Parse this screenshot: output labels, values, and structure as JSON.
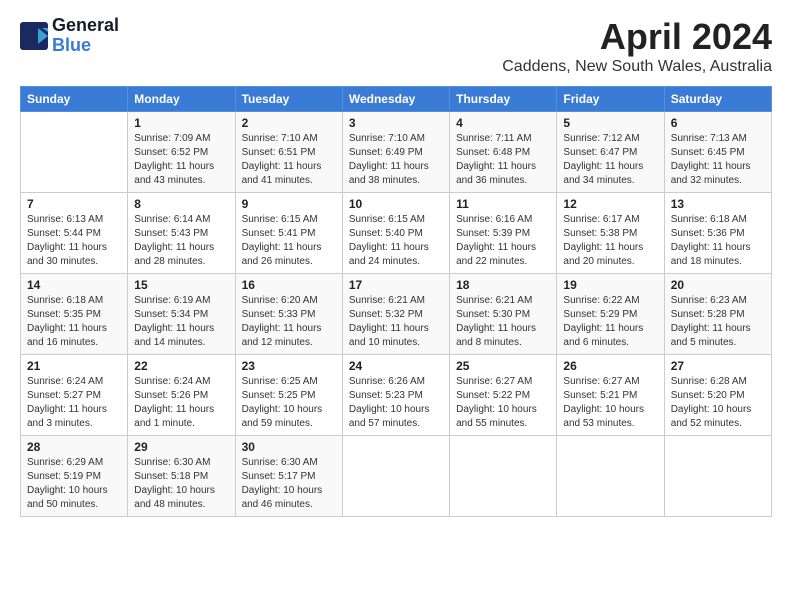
{
  "logo": {
    "line1": "General",
    "line2": "Blue"
  },
  "title": "April 2024",
  "subtitle": "Caddens, New South Wales, Australia",
  "days_header": [
    "Sunday",
    "Monday",
    "Tuesday",
    "Wednesday",
    "Thursday",
    "Friday",
    "Saturday"
  ],
  "weeks": [
    [
      {
        "day": "",
        "info": ""
      },
      {
        "day": "1",
        "info": "Sunrise: 7:09 AM\nSunset: 6:52 PM\nDaylight: 11 hours\nand 43 minutes."
      },
      {
        "day": "2",
        "info": "Sunrise: 7:10 AM\nSunset: 6:51 PM\nDaylight: 11 hours\nand 41 minutes."
      },
      {
        "day": "3",
        "info": "Sunrise: 7:10 AM\nSunset: 6:49 PM\nDaylight: 11 hours\nand 38 minutes."
      },
      {
        "day": "4",
        "info": "Sunrise: 7:11 AM\nSunset: 6:48 PM\nDaylight: 11 hours\nand 36 minutes."
      },
      {
        "day": "5",
        "info": "Sunrise: 7:12 AM\nSunset: 6:47 PM\nDaylight: 11 hours\nand 34 minutes."
      },
      {
        "day": "6",
        "info": "Sunrise: 7:13 AM\nSunset: 6:45 PM\nDaylight: 11 hours\nand 32 minutes."
      }
    ],
    [
      {
        "day": "7",
        "info": "Sunrise: 6:13 AM\nSunset: 5:44 PM\nDaylight: 11 hours\nand 30 minutes."
      },
      {
        "day": "8",
        "info": "Sunrise: 6:14 AM\nSunset: 5:43 PM\nDaylight: 11 hours\nand 28 minutes."
      },
      {
        "day": "9",
        "info": "Sunrise: 6:15 AM\nSunset: 5:41 PM\nDaylight: 11 hours\nand 26 minutes."
      },
      {
        "day": "10",
        "info": "Sunrise: 6:15 AM\nSunset: 5:40 PM\nDaylight: 11 hours\nand 24 minutes."
      },
      {
        "day": "11",
        "info": "Sunrise: 6:16 AM\nSunset: 5:39 PM\nDaylight: 11 hours\nand 22 minutes."
      },
      {
        "day": "12",
        "info": "Sunrise: 6:17 AM\nSunset: 5:38 PM\nDaylight: 11 hours\nand 20 minutes."
      },
      {
        "day": "13",
        "info": "Sunrise: 6:18 AM\nSunset: 5:36 PM\nDaylight: 11 hours\nand 18 minutes."
      }
    ],
    [
      {
        "day": "14",
        "info": "Sunrise: 6:18 AM\nSunset: 5:35 PM\nDaylight: 11 hours\nand 16 minutes."
      },
      {
        "day": "15",
        "info": "Sunrise: 6:19 AM\nSunset: 5:34 PM\nDaylight: 11 hours\nand 14 minutes."
      },
      {
        "day": "16",
        "info": "Sunrise: 6:20 AM\nSunset: 5:33 PM\nDaylight: 11 hours\nand 12 minutes."
      },
      {
        "day": "17",
        "info": "Sunrise: 6:21 AM\nSunset: 5:32 PM\nDaylight: 11 hours\nand 10 minutes."
      },
      {
        "day": "18",
        "info": "Sunrise: 6:21 AM\nSunset: 5:30 PM\nDaylight: 11 hours\nand 8 minutes."
      },
      {
        "day": "19",
        "info": "Sunrise: 6:22 AM\nSunset: 5:29 PM\nDaylight: 11 hours\nand 6 minutes."
      },
      {
        "day": "20",
        "info": "Sunrise: 6:23 AM\nSunset: 5:28 PM\nDaylight: 11 hours\nand 5 minutes."
      }
    ],
    [
      {
        "day": "21",
        "info": "Sunrise: 6:24 AM\nSunset: 5:27 PM\nDaylight: 11 hours\nand 3 minutes."
      },
      {
        "day": "22",
        "info": "Sunrise: 6:24 AM\nSunset: 5:26 PM\nDaylight: 11 hours\nand 1 minute."
      },
      {
        "day": "23",
        "info": "Sunrise: 6:25 AM\nSunset: 5:25 PM\nDaylight: 10 hours\nand 59 minutes."
      },
      {
        "day": "24",
        "info": "Sunrise: 6:26 AM\nSunset: 5:23 PM\nDaylight: 10 hours\nand 57 minutes."
      },
      {
        "day": "25",
        "info": "Sunrise: 6:27 AM\nSunset: 5:22 PM\nDaylight: 10 hours\nand 55 minutes."
      },
      {
        "day": "26",
        "info": "Sunrise: 6:27 AM\nSunset: 5:21 PM\nDaylight: 10 hours\nand 53 minutes."
      },
      {
        "day": "27",
        "info": "Sunrise: 6:28 AM\nSunset: 5:20 PM\nDaylight: 10 hours\nand 52 minutes."
      }
    ],
    [
      {
        "day": "28",
        "info": "Sunrise: 6:29 AM\nSunset: 5:19 PM\nDaylight: 10 hours\nand 50 minutes."
      },
      {
        "day": "29",
        "info": "Sunrise: 6:30 AM\nSunset: 5:18 PM\nDaylight: 10 hours\nand 48 minutes."
      },
      {
        "day": "30",
        "info": "Sunrise: 6:30 AM\nSunset: 5:17 PM\nDaylight: 10 hours\nand 46 minutes."
      },
      {
        "day": "",
        "info": ""
      },
      {
        "day": "",
        "info": ""
      },
      {
        "day": "",
        "info": ""
      },
      {
        "day": "",
        "info": ""
      }
    ]
  ]
}
